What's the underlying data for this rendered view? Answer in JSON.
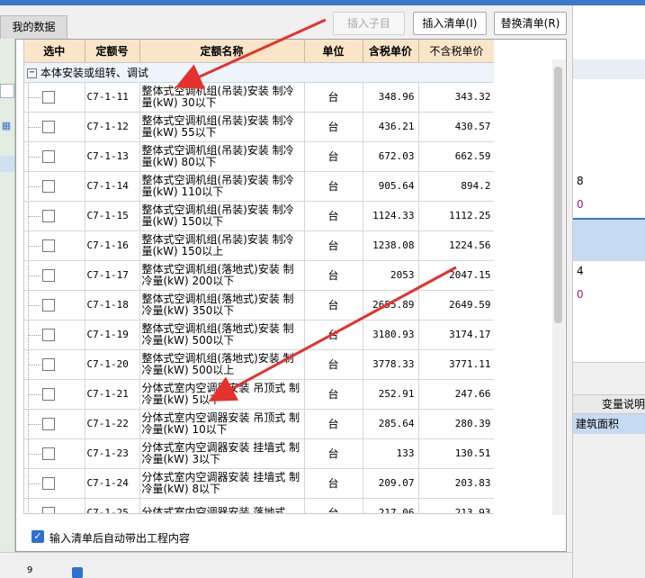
{
  "window": {
    "tab_label": "我的数据"
  },
  "toolbar": {
    "insert_sub_label": "插入子目",
    "insert_list_label": "插入清单(I)",
    "replace_list_label": "替换清单(R)"
  },
  "table": {
    "headers": [
      "选中",
      "定额号",
      "定额名称",
      "单位",
      "含税单价",
      "不含税单价"
    ],
    "group_label": "本体安装或组转、调试",
    "rows": [
      {
        "code": "C7-1-11",
        "name": "整体式空调机组(吊装)安装 制冷量(kW) 30以下",
        "unit": "台",
        "price_tax": "348.96",
        "price_notax": "343.32"
      },
      {
        "code": "C7-1-12",
        "name": "整体式空调机组(吊装)安装 制冷量(kW) 55以下",
        "unit": "台",
        "price_tax": "436.21",
        "price_notax": "430.57"
      },
      {
        "code": "C7-1-13",
        "name": "整体式空调机组(吊装)安装 制冷量(kW) 80以下",
        "unit": "台",
        "price_tax": "672.03",
        "price_notax": "662.59"
      },
      {
        "code": "C7-1-14",
        "name": "整体式空调机组(吊装)安装 制冷量(kW) 110以下",
        "unit": "台",
        "price_tax": "905.64",
        "price_notax": "894.2"
      },
      {
        "code": "C7-1-15",
        "name": "整体式空调机组(吊装)安装 制冷量(kW) 150以下",
        "unit": "台",
        "price_tax": "1124.33",
        "price_notax": "1112.25"
      },
      {
        "code": "C7-1-16",
        "name": "整体式空调机组(吊装)安装 制冷量(kW) 150以上",
        "unit": "台",
        "price_tax": "1238.08",
        "price_notax": "1224.56"
      },
      {
        "code": "C7-1-17",
        "name": "整体式空调机组(落地式)安装 制冷量(kW) 200以下",
        "unit": "台",
        "price_tax": "2053",
        "price_notax": "2047.15"
      },
      {
        "code": "C7-1-18",
        "name": "整体式空调机组(落地式)安装 制冷量(kW) 350以下",
        "unit": "台",
        "price_tax": "2655.89",
        "price_notax": "2649.59"
      },
      {
        "code": "C7-1-19",
        "name": "整体式空调机组(落地式)安装 制冷量(kW) 500以下",
        "unit": "台",
        "price_tax": "3180.93",
        "price_notax": "3174.17"
      },
      {
        "code": "C7-1-20",
        "name": "整体式空调机组(落地式)安装 制冷量(kW) 500以上",
        "unit": "台",
        "price_tax": "3778.33",
        "price_notax": "3771.11"
      },
      {
        "code": "C7-1-21",
        "name": "分体式室内空调器安装 吊顶式 制冷量(kW) 5以下",
        "unit": "台",
        "price_tax": "252.91",
        "price_notax": "247.66"
      },
      {
        "code": "C7-1-22",
        "name": "分体式室内空调器安装 吊顶式 制冷量(kW) 10以下",
        "unit": "台",
        "price_tax": "285.64",
        "price_notax": "280.39"
      },
      {
        "code": "C7-1-23",
        "name": "分体式室内空调器安装 挂墙式 制冷量(kW) 3以下",
        "unit": "台",
        "price_tax": "133",
        "price_notax": "130.51"
      },
      {
        "code": "C7-1-24",
        "name": "分体式室内空调器安装 挂墙式 制冷量(kW) 8以下",
        "unit": "台",
        "price_tax": "209.07",
        "price_notax": "203.83"
      },
      {
        "code": "C7-1-25",
        "name": "分体式室内空调器安装 落地式",
        "unit": "台",
        "price_tax": "217.06",
        "price_notax": "213.93"
      }
    ]
  },
  "footer": {
    "auto_content_label": "输入清单后自动带出工程内容",
    "auto_content_checked": true
  },
  "right_panel": {
    "num_a": "8",
    "num_b": "0",
    "num_c": "4",
    "num_d": "0",
    "header_label": "变量说明",
    "cell_label": "建筑面积"
  },
  "bottom": {
    "num": "9"
  },
  "colors": {
    "header_bg": "#fbe5c8",
    "group_bg": "#eef4fb",
    "arrow": "#e5322d",
    "accent": "#2f6fd1"
  }
}
